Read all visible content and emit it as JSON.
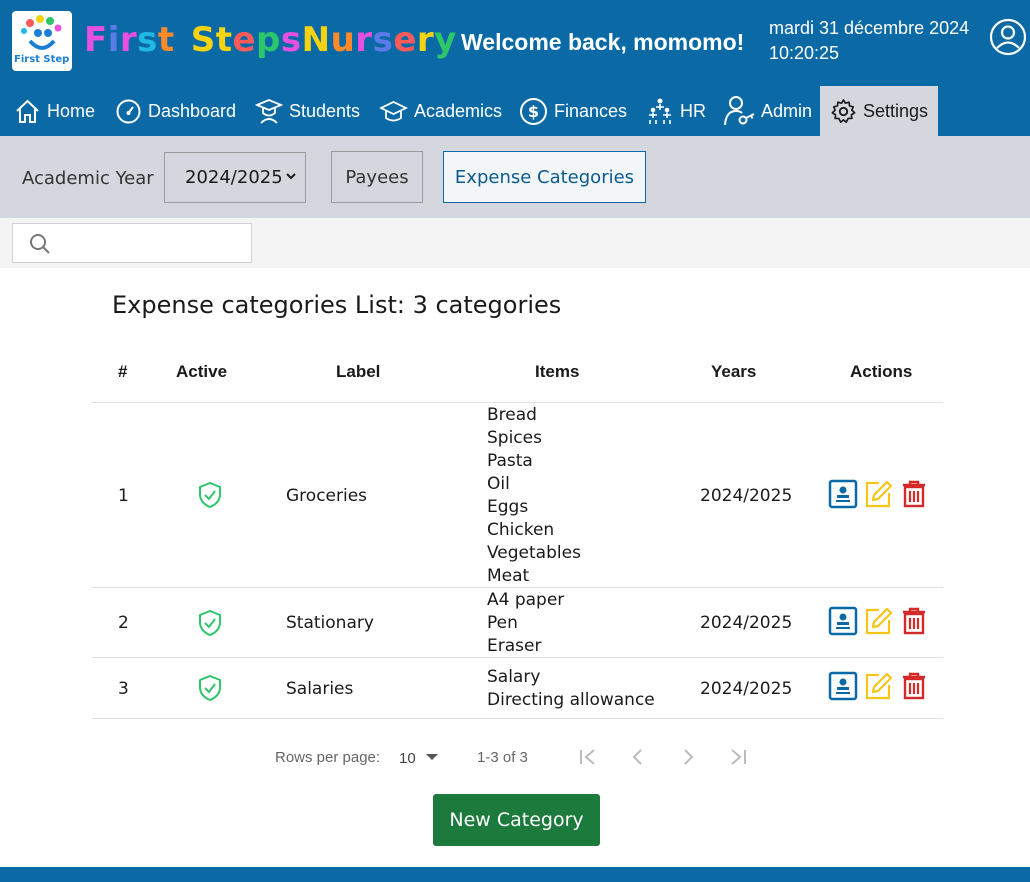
{
  "header": {
    "logo_text": "First Step",
    "brand_words": [
      {
        "letters": [
          {
            "ch": "F",
            "color": "#e94fe0"
          },
          {
            "ch": "i",
            "color": "#5a7be8"
          },
          {
            "ch": "r",
            "color": "#e94fe0"
          },
          {
            "ch": "s",
            "color": "#22b8e6"
          },
          {
            "ch": "t",
            "color": "#ff8a2a"
          }
        ]
      },
      {
        "letters": [
          {
            "ch": "S",
            "color": "#f5d311"
          },
          {
            "ch": "t",
            "color": "#f5d311"
          },
          {
            "ch": "e",
            "color": "#ff5a5a"
          },
          {
            "ch": "p",
            "color": "#2ec66a"
          },
          {
            "ch": "s",
            "color": "#e94fe0"
          }
        ]
      },
      {
        "letters": [
          {
            "ch": "N",
            "color": "#f5d311"
          },
          {
            "ch": "u",
            "color": "#ff8a2a"
          },
          {
            "ch": "r",
            "color": "#e94fe0"
          },
          {
            "ch": "s",
            "color": "#5a7be8"
          },
          {
            "ch": "e",
            "color": "#ff5a5a"
          },
          {
            "ch": "r",
            "color": "#f5d311"
          },
          {
            "ch": "y",
            "color": "#2ec66a"
          }
        ]
      }
    ],
    "welcome": "Welcome back, momomo!",
    "date": "mardi 31 décembre 2024",
    "time": "10:20:25"
  },
  "nav": {
    "home": "Home",
    "dashboard": "Dashboard",
    "students": "Students",
    "academics": "Academics",
    "finances": "Finances",
    "hr": "HR",
    "admin": "Admin",
    "settings": "Settings"
  },
  "toolbar": {
    "academic_year_label": "Academic Year",
    "academic_year_value": "2024/2025",
    "payees": "Payees",
    "expense_categories": "Expense Categories"
  },
  "search": {
    "placeholder": ""
  },
  "list": {
    "title": "Expense categories List: 3 categories",
    "columns": [
      "#",
      "Active",
      "Label",
      "Items",
      "Years",
      "Actions"
    ],
    "rows": [
      {
        "num": "1",
        "label": "Groceries",
        "items": [
          "Bread",
          "Spices",
          "Pasta",
          "Oil",
          "Eggs",
          "Chicken",
          "Vegetables",
          "Meat"
        ],
        "years": "2024/2025"
      },
      {
        "num": "2",
        "label": "Stationary",
        "items": [
          "A4 paper",
          "Pen",
          "Eraser"
        ],
        "years": "2024/2025"
      },
      {
        "num": "3",
        "label": "Salaries",
        "items": [
          "Salary",
          "Directing allowance"
        ],
        "years": "2024/2025"
      }
    ]
  },
  "pagination": {
    "rows_per_page_label": "Rows per page:",
    "rows_per_page_value": "10",
    "range": "1-3 of 3"
  },
  "new_category": "New Category",
  "colors": {
    "primary": "#0b6aa6",
    "active_green": "#2ec66a",
    "edit_yellow": "#f5c518",
    "delete_red": "#d42a2a",
    "button_green": "#1c7a3c"
  }
}
